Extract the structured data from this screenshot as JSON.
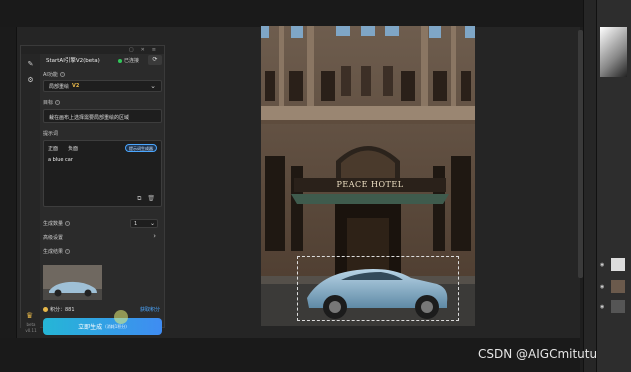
{
  "plugin": {
    "title": "StartAI引擎V2(beta)",
    "status": "已连接",
    "side_label_1": "beta",
    "side_label_2": "v0.11",
    "ai_function_label": "AI功能",
    "ai_function_value": "局部重绘",
    "ai_function_badge": "V2",
    "target_label": "目标",
    "target_text": "裁在画布上选择需要局部重绘的区域",
    "prompt_label": "提示词",
    "tab_positive": "正面",
    "tab_negative": "负面",
    "prompt_generator": "提示词生成器",
    "prompt_text": "a blue car",
    "count_label": "生成数量",
    "count_value": "1",
    "advanced_label": "高级设置",
    "result_label": "生成结果",
    "points_label": "积分：881",
    "get_points": "获取积分",
    "generate_button": "立即生成",
    "generate_cost": "(消耗1积分)"
  },
  "document": {
    "sign_text": "PEACE HOTEL"
  },
  "watermark": "CSDN @AIGCmitutu",
  "colors": {
    "accent_blue": "#3f8cf2",
    "accent_cyan": "#25b6d6",
    "status_green": "#31c75a",
    "gold": "#e8b84a"
  }
}
